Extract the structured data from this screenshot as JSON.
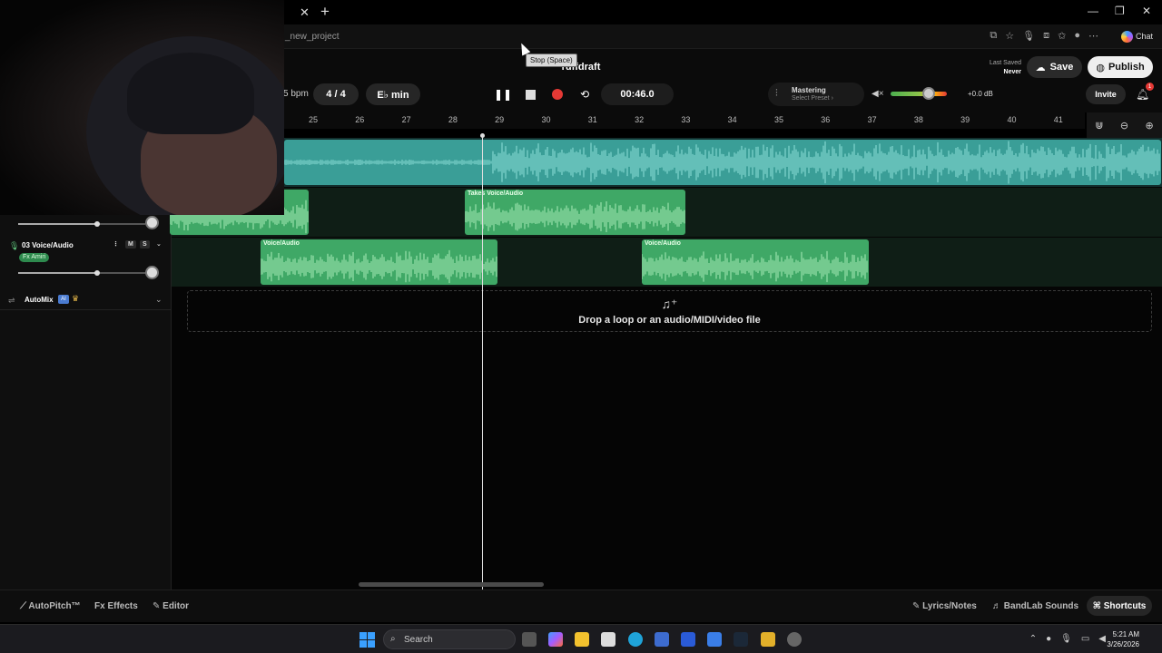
{
  "browser": {
    "url_fragment": "_new_project",
    "chat_label": "Chat",
    "close_tab": "✕",
    "new_tab": "+",
    "minimize": "—",
    "restore": "❐",
    "close": "✕"
  },
  "header": {
    "project_title": "ruffdraft",
    "bpm_label": "5 bpm",
    "time_signature": "4 / 4",
    "key": "E♭ min",
    "time": "00:46.0",
    "tooltip": "Stop (Space)",
    "mastering_title": "Mastering",
    "mastering_preset": "Select Preset ›",
    "volume_db": "+0.0 dB",
    "last_saved_label": "Last Saved",
    "last_saved_value": "Never",
    "save_label": "Save",
    "publish_label": "Publish",
    "invite_label": "Invite",
    "notification_count": "1",
    "volume_level": 0.67
  },
  "ruler": {
    "ticks": [
      "25",
      "26",
      "27",
      "28",
      "29",
      "30",
      "31",
      "32",
      "33",
      "34",
      "35",
      "36",
      "37",
      "38",
      "39",
      "40",
      "41"
    ]
  },
  "tracks": {
    "track2": {
      "clips": [
        {
          "label": ""
        },
        {
          "label": "Takes  Voice/Audio"
        }
      ]
    },
    "track3": {
      "name": "03  Voice/Audio",
      "mute": "M",
      "solo": "S",
      "fx": "Fx Amiri",
      "clips": [
        {
          "label": "Voice/Audio"
        },
        {
          "label": "Voice/Audio"
        }
      ]
    },
    "automix": {
      "label": "AutoMix",
      "ai": "AI"
    }
  },
  "droparea": {
    "text": "Drop a loop or an audio/MIDI/video file"
  },
  "bottom": {
    "autopitch": "AutoPitch™",
    "effects": "Effects",
    "editor": "Editor",
    "lyrics": "Lyrics/Notes",
    "sounds": "BandLab Sounds",
    "shortcuts": "Shortcuts"
  },
  "taskbar": {
    "search": "Search",
    "time": "5:21 AM",
    "date": "3/26/2026"
  },
  "colors": {
    "clip_green": "#3fa866",
    "clip_teal": "#3a9e97",
    "record": "#e53935"
  }
}
